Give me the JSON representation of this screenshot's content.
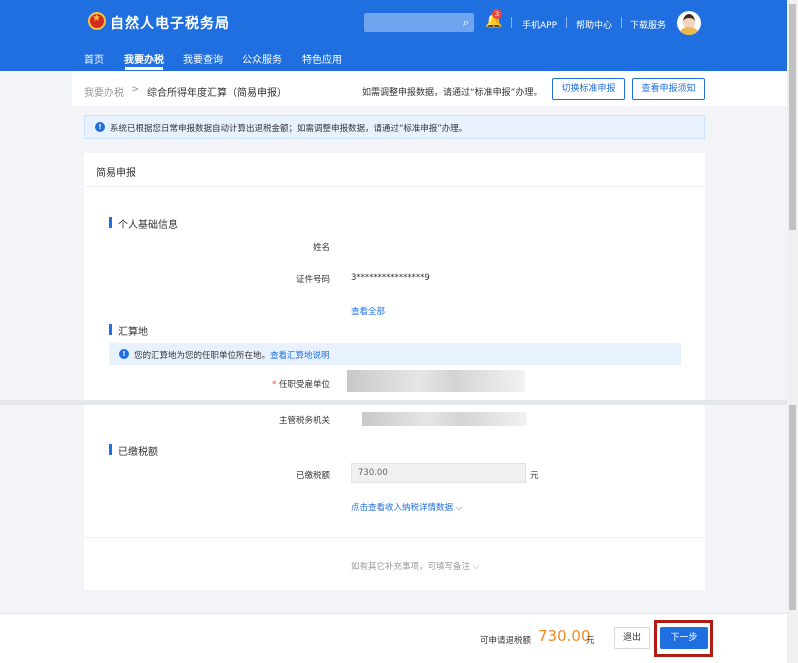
{
  "header": {
    "title": "自然人电子税务局",
    "notification_count": "3",
    "links": [
      "手机APP",
      "帮助中心",
      "下载服务"
    ]
  },
  "nav": {
    "items": [
      "首页",
      "我要办税",
      "我要查询",
      "公众服务",
      "特色应用"
    ],
    "active": "我要办税"
  },
  "breadcrumb": {
    "root": "我要办税",
    "separator": ">",
    "current": "综合所得年度汇算（简易申报）",
    "hint": "如需调整申报数据，请通过“标准申报”办理。",
    "switch_button": "切换标准申报",
    "guide_button": "查看申报须知"
  },
  "notice": {
    "text": "系统已根据您日常申报数据自动计算出退税金额；如需调整申报数据，请通过“标准申报”办理。"
  },
  "card": {
    "title": "简易申报",
    "personal": {
      "section_title": "个人基础信息",
      "name_label": "姓名",
      "id_label": "证件号码",
      "id_value": "3****************9",
      "view_all": "查看全部"
    },
    "location": {
      "section_title": "汇算地",
      "notice_text": "您的汇算地为您的任职单位所在地。",
      "notice_link": "查看汇算地说明",
      "employer_label": "任职受雇单位",
      "required_mark": "*",
      "tax_office_label": "主管税务机关"
    },
    "paid": {
      "section_title": "已缴税额",
      "paid_label": "已缴税额",
      "paid_value": "730.00",
      "unit": "元",
      "detail_link": "点击查看收入纳税详情数据",
      "supplement_hint": "如有其它补充事项，可填写备注"
    }
  },
  "footer": {
    "refund_label": "可申请退税额",
    "refund_amount": "730.00",
    "refund_unit": "元",
    "exit_button": "退出",
    "next_button": "下一步"
  },
  "colors": {
    "brand": "#1f6fe0",
    "amount": "#f08a24",
    "highlight": "#b31c14"
  }
}
